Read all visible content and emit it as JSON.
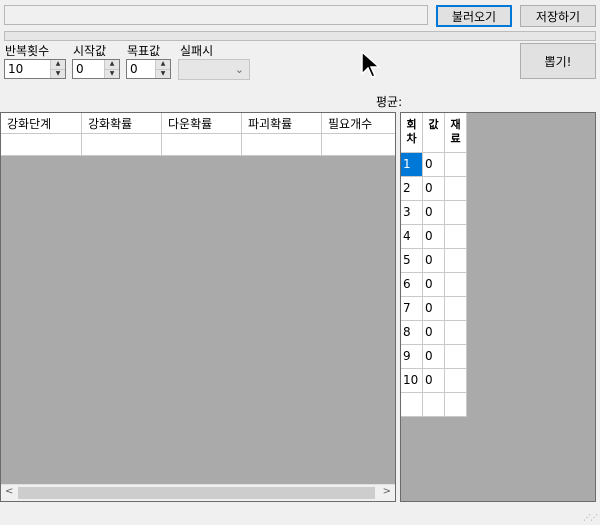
{
  "toolbar": {
    "path_value": "",
    "load_label": "불러오기",
    "save_label": "저장하기"
  },
  "progress": {
    "value_percent": 0
  },
  "settings": {
    "repeat_label": "반복횟수",
    "repeat_value": "10",
    "start_label": "시작값",
    "start_value": "0",
    "target_label": "목표값",
    "target_value": "0",
    "fail_label": "실패시",
    "fail_value": ""
  },
  "draw_label": "뽑기!",
  "average": {
    "label": "평균:",
    "value": ""
  },
  "main_grid": {
    "columns": [
      "강화단계",
      "강화확률",
      "다운확률",
      "파괴확률",
      "필요개수"
    ],
    "rows": [
      [
        "",
        "",
        "",
        "",
        ""
      ]
    ]
  },
  "round_grid": {
    "columns": [
      "회\n차",
      "값",
      "재\n료"
    ],
    "rows": [
      [
        "1",
        "0",
        ""
      ],
      [
        "2",
        "0",
        ""
      ],
      [
        "3",
        "0",
        ""
      ],
      [
        "4",
        "0",
        ""
      ],
      [
        "5",
        "0",
        ""
      ],
      [
        "6",
        "0",
        ""
      ],
      [
        "7",
        "0",
        ""
      ],
      [
        "8",
        "0",
        ""
      ],
      [
        "9",
        "0",
        ""
      ],
      [
        "10",
        "0",
        ""
      ],
      [
        "",
        "",
        ""
      ]
    ],
    "selected_row": 0
  },
  "icons": {
    "spin_up": "triangle-up",
    "spin_down": "triangle-down",
    "dropdown": "chevron-down",
    "scroll_left": "arrow-left",
    "scroll_right": "arrow-right",
    "resize": "resize-grip",
    "cursor": "mouse-pointer"
  },
  "colors": {
    "selection": "#0078d7",
    "grid_background": "#abaaab",
    "primary_border": "#0078d7"
  }
}
